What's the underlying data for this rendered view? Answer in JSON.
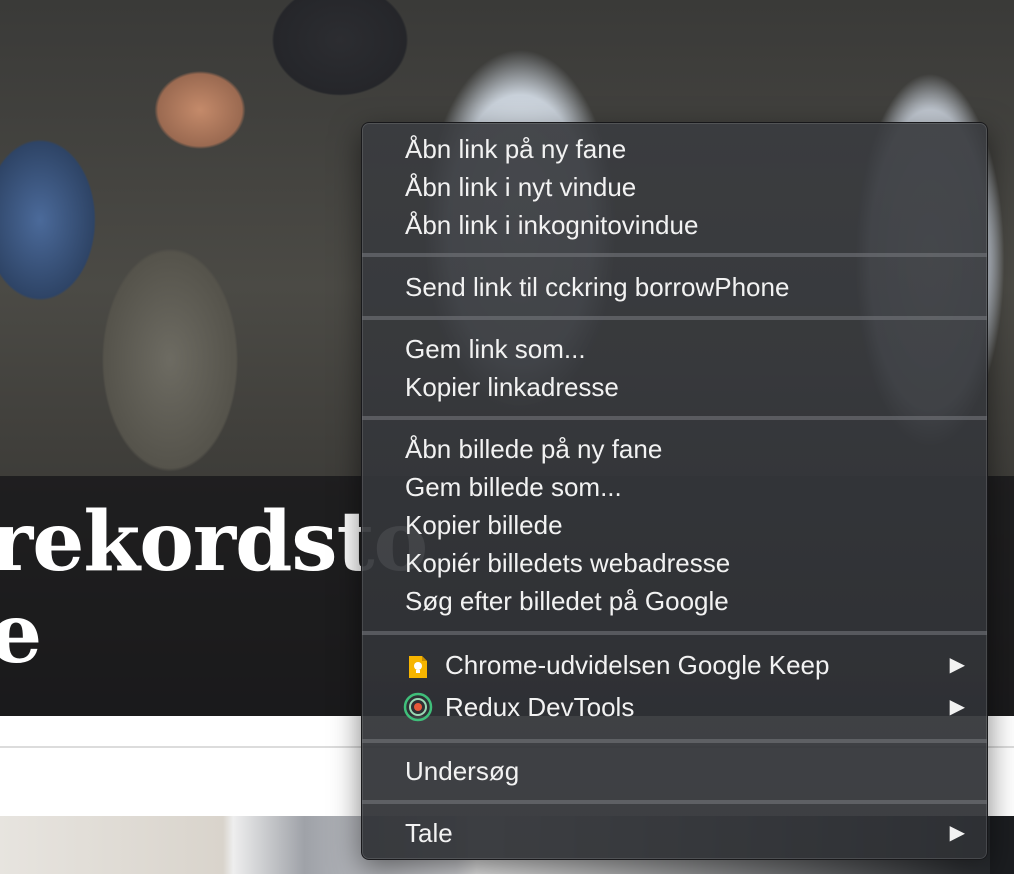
{
  "background": {
    "headline_line1": "rekordsto",
    "headline_line2": "e"
  },
  "context_menu": {
    "groups": [
      {
        "items": [
          {
            "label": "Åbn link på ny fane"
          },
          {
            "label": "Åbn link i nyt vindue"
          },
          {
            "label": "Åbn link i inkognitovindue"
          }
        ]
      },
      {
        "items": [
          {
            "label": "Send link til cckring borrowPhone"
          }
        ]
      },
      {
        "items": [
          {
            "label": "Gem link som..."
          },
          {
            "label": "Kopier linkadresse"
          }
        ]
      },
      {
        "items": [
          {
            "label": "Åbn billede på ny fane"
          },
          {
            "label": "Gem billede som..."
          },
          {
            "label": "Kopier billede"
          },
          {
            "label": "Kopiér billedets webadresse"
          },
          {
            "label": "Søg efter billedet på Google"
          }
        ]
      },
      {
        "items": [
          {
            "label": "Chrome-udvidelsen Google Keep",
            "icon": "google-keep-icon",
            "submenu_arrow": "▶"
          },
          {
            "label": "Redux DevTools",
            "icon": "redux-devtools-icon",
            "submenu_arrow": "▶"
          }
        ]
      },
      {
        "items": [
          {
            "label": "Undersøg"
          }
        ]
      },
      {
        "items": [
          {
            "label": "Tale",
            "submenu_arrow": "▶"
          }
        ]
      }
    ]
  },
  "colors": {
    "menu_text": "#f2f2f2",
    "keep_yellow": "#f7b500",
    "redux_green": "#3fbf7a"
  }
}
